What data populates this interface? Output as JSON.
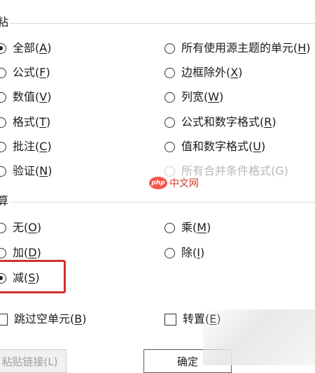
{
  "paste_group": {
    "label": "粘",
    "options": [
      {
        "text": "全部",
        "key": "A",
        "checked": true
      },
      {
        "text": "公式",
        "key": "F"
      },
      {
        "text": "数值",
        "key": "V"
      },
      {
        "text": "格式",
        "key": "T"
      },
      {
        "text": "批注",
        "key": "C"
      },
      {
        "text": "验证",
        "key": "N"
      },
      {
        "text": "所有使用源主题的单元",
        "key": "H"
      },
      {
        "text": "边框除外",
        "key": "X"
      },
      {
        "text": "列宽",
        "key": "W"
      },
      {
        "text": "公式和数字格式",
        "key": "R"
      },
      {
        "text": "值和数字格式",
        "key": "U"
      },
      {
        "text": "所有合并条件格式(G)",
        "key": "",
        "disabled": true
      }
    ]
  },
  "operation_group": {
    "label": "算",
    "options": [
      {
        "text": "无",
        "key": "O"
      },
      {
        "text": "加",
        "key": "D"
      },
      {
        "text": "减",
        "key": "S",
        "checked": true
      },
      {
        "text": "乘",
        "key": "M"
      },
      {
        "text": "除",
        "key": "I"
      }
    ]
  },
  "checkboxes": {
    "skip_blanks": {
      "text": "跳过空单元",
      "key": "B"
    },
    "transpose": {
      "text": "转置",
      "key": "E"
    }
  },
  "buttons": {
    "paste_link": "粘贴链接(L)",
    "ok": "确定"
  },
  "watermark": {
    "logo": "php",
    "text": "中文网"
  },
  "colors": {
    "highlight": "#d0312d"
  }
}
